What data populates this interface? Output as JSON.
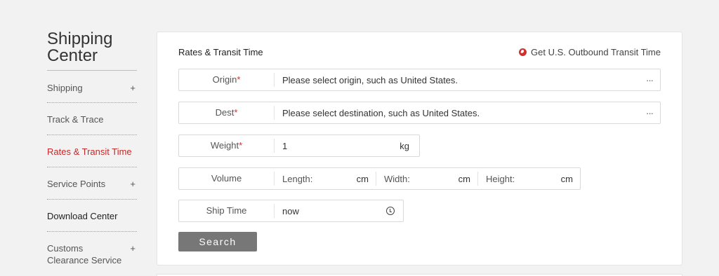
{
  "sidebar": {
    "title": "Shipping Center",
    "items": [
      {
        "label": "Shipping",
        "plus": "+"
      },
      {
        "label": "Track & Trace"
      },
      {
        "label": "Rates & Transit Time"
      },
      {
        "label": "Service Points",
        "plus": "+"
      },
      {
        "label": "Download Center"
      },
      {
        "label": "Customs Clearance Service",
        "plus": "+"
      }
    ]
  },
  "panel": {
    "title": "Rates & Transit Time",
    "outbound_link": "Get U.S. Outbound Transit Time",
    "origin": {
      "label": "Origin",
      "required": "*",
      "placeholder": "Please select origin, such as United States.",
      "more": "···"
    },
    "dest": {
      "label": "Dest",
      "required": "*",
      "placeholder": "Please select destination, such as United States.",
      "more": "···"
    },
    "weight": {
      "label": "Weight",
      "required": "*",
      "value": "1",
      "unit": "kg"
    },
    "volume": {
      "label": "Volume",
      "length_label": "Length:",
      "width_label": "Width:",
      "height_label": "Height:",
      "unit": "cm"
    },
    "ship_time": {
      "label": "Ship Time",
      "value": "now"
    },
    "search_label": "Search"
  },
  "colors": {
    "accent": "#c62828",
    "button": "#777777"
  }
}
